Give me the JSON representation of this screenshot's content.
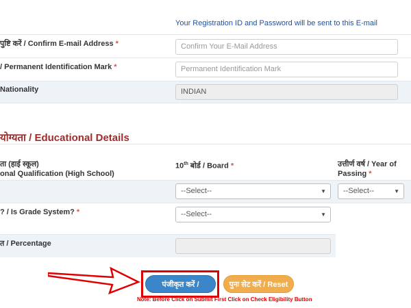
{
  "info_text": "Your Registration ID and Password will be sent to this E-mail",
  "confirm_email": {
    "label": "पुष्टि करें / Confirm E-mail Address",
    "required": "*",
    "placeholder": "Confirm Your E-Mail Address"
  },
  "identification_mark": {
    "label": "/ Permanent Identification Mark",
    "required": "*",
    "placeholder": "Permanent Identification Mark"
  },
  "nationality": {
    "label": "Nationality",
    "value": "INDIAN"
  },
  "education_section": {
    "title": "योग्यता / Educational Details"
  },
  "qualification": {
    "label_line1": "ता (हाई स्कूल)",
    "label_line2": "onal Qualification (High School)"
  },
  "board": {
    "label_prefix": "10",
    "label_sup": "th",
    "label_rest": " बोर्ड / Board",
    "required": "*",
    "selected": "--Select--"
  },
  "year_of_passing": {
    "label_line1": "उत्तीर्ण वर्ष / Year of",
    "label_line2": "Passing",
    "required": "*",
    "selected": "--Select--"
  },
  "grade_system": {
    "label": "? / Is Grade System?",
    "required": "*",
    "selected": "--Select--"
  },
  "percentage": {
    "label": "त / Percentage",
    "value": ""
  },
  "buttons": {
    "register": "पंजीकृत करें / Register",
    "reset": "पुनः सेट करें / Reset"
  },
  "note": "Note: Before Click on Submit First Click on Check Eligibility Button",
  "colors": {
    "highlight": "#e00000",
    "register_button": "#3a86c8",
    "reset_button": "#f0ad4e",
    "section_title": "#a02b2b"
  }
}
